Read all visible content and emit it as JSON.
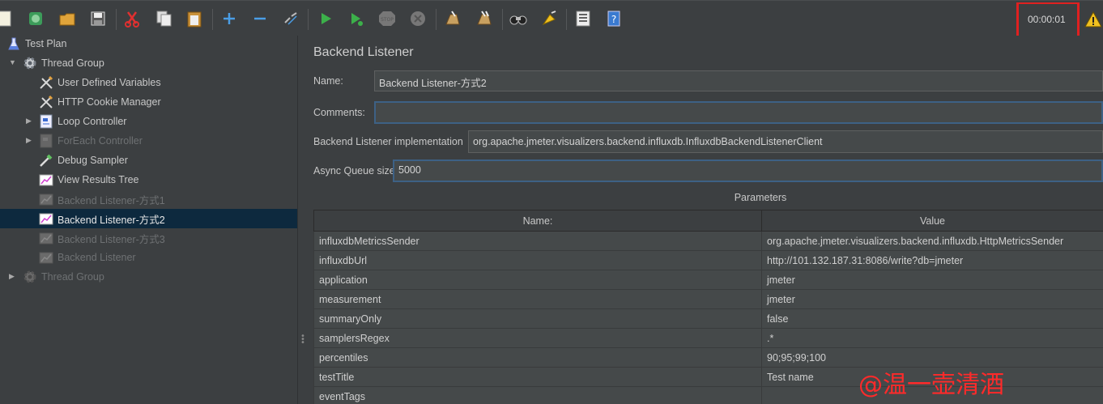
{
  "toolbar": {
    "icons": [
      "new-icon",
      "templates-icon",
      "open-icon",
      "save-icon",
      "cut-icon",
      "copy-icon",
      "paste-icon",
      "expand-icon",
      "collapse-icon",
      "toggle-icon",
      "start-icon",
      "start-no-pauses-icon",
      "stop-icon",
      "shutdown-icon",
      "clear-icon",
      "clear-all-icon",
      "search-icon",
      "reset-search-icon",
      "function-helper-icon",
      "help-icon"
    ],
    "timer": "00:00:01"
  },
  "tree": {
    "items": [
      {
        "label": "Test Plan",
        "icon": "flask-icon",
        "disabled": false,
        "selected": false
      },
      {
        "label": "Thread Group",
        "icon": "gear-icon",
        "disabled": false,
        "selected": false
      },
      {
        "label": "User Defined Variables",
        "icon": "wrench-icon",
        "disabled": false,
        "selected": false
      },
      {
        "label": "HTTP Cookie Manager",
        "icon": "wrench-icon",
        "disabled": false,
        "selected": false
      },
      {
        "label": "Loop Controller",
        "icon": "controller-icon",
        "disabled": false,
        "selected": false
      },
      {
        "label": "ForEach Controller",
        "icon": "controller-icon",
        "disabled": true,
        "selected": false
      },
      {
        "label": "Debug Sampler",
        "icon": "pipette-icon",
        "disabled": false,
        "selected": false
      },
      {
        "label": "View Results Tree",
        "icon": "listener-icon",
        "disabled": false,
        "selected": false
      },
      {
        "label": "Backend Listener-方式1",
        "icon": "listener-icon",
        "disabled": true,
        "selected": false
      },
      {
        "label": "Backend Listener-方式2",
        "icon": "listener-icon",
        "disabled": false,
        "selected": true
      },
      {
        "label": "Backend Listener-方式3",
        "icon": "listener-icon",
        "disabled": true,
        "selected": false
      },
      {
        "label": "Backend Listener",
        "icon": "listener-icon",
        "disabled": true,
        "selected": false
      },
      {
        "label": "Thread Group",
        "icon": "gear-icon",
        "disabled": true,
        "selected": false
      }
    ]
  },
  "panel": {
    "title": "Backend Listener",
    "name_label": "Name:",
    "name_value": "Backend Listener-方式2",
    "comments_label": "Comments:",
    "comments_value": "",
    "impl_label": "Backend Listener implementation",
    "impl_value": "org.apache.jmeter.visualizers.backend.influxdb.InfluxdbBackendListenerClient",
    "queue_label": "Async Queue size",
    "queue_value": "5000",
    "params_title": "Parameters",
    "columns": [
      "Name:",
      "Value"
    ],
    "rows": [
      [
        "influxdbMetricsSender",
        "org.apache.jmeter.visualizers.backend.influxdb.HttpMetricsSender"
      ],
      [
        "influxdbUrl",
        "http://101.132.187.31:8086/write?db=jmeter"
      ],
      [
        "application",
        "jmeter"
      ],
      [
        "measurement",
        "jmeter"
      ],
      [
        "summaryOnly",
        "false"
      ],
      [
        "samplersRegex",
        ".*"
      ],
      [
        "percentiles",
        "90;95;99;100"
      ],
      [
        "testTitle",
        "Test name"
      ],
      [
        "eventTags",
        ""
      ]
    ]
  },
  "watermark": "@温一壶清酒"
}
